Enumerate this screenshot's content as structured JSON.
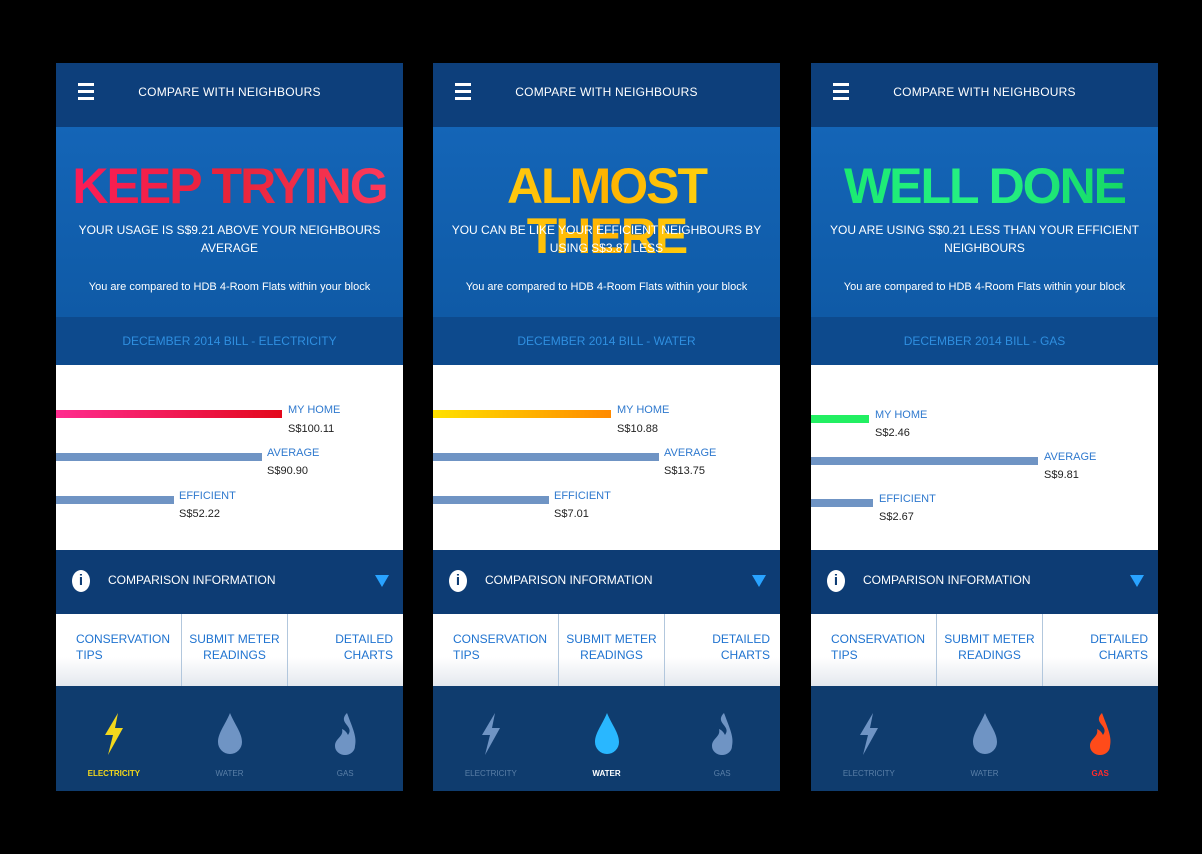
{
  "screens": [
    {
      "title": "COMPARE WITH NEIGHBOURS",
      "headline": "KEEP TRYING",
      "subtitle": "YOUR USAGE IS S$9.21 ABOVE YOUR NEIGHBOURS AVERAGE",
      "compared_text": "You are compared to HDB 4-Room Flats within your block",
      "bill_label": "DECEMBER 2014 BILL - ELECTRICITY",
      "bars": [
        {
          "label": "MY HOME",
          "value": "S$100.11",
          "amount": 100.11
        },
        {
          "label": "AVERAGE",
          "value": "S$90.90",
          "amount": 90.9
        },
        {
          "label": "EFFICIENT",
          "value": "S$52.22",
          "amount": 52.22
        }
      ],
      "info_label": "COMPARISON INFORMATION",
      "actions": [
        "CONSERVATION TIPS",
        "SUBMIT METER READINGS",
        "DETAILED CHARTS"
      ],
      "tabs": [
        "ELECTRICITY",
        "WATER",
        "GAS"
      ],
      "active_tab": "ELECTRICITY"
    },
    {
      "title": "COMPARE WITH NEIGHBOURS",
      "headline": "ALMOST THERE",
      "subtitle": "YOU CAN BE LIKE YOUR EFFICIENT NEIGHBOURS BY USING S$3.87 LESS",
      "compared_text": "You are compared to HDB 4-Room Flats within your block",
      "bill_label": "DECEMBER 2014 BILL - WATER",
      "bars": [
        {
          "label": "MY HOME",
          "value": "S$10.88",
          "amount": 10.88
        },
        {
          "label": "AVERAGE",
          "value": "S$13.75",
          "amount": 13.75
        },
        {
          "label": "EFFICIENT",
          "value": "S$7.01",
          "amount": 7.01
        }
      ],
      "info_label": "COMPARISON INFORMATION",
      "actions": [
        "CONSERVATION TIPS",
        "SUBMIT METER READINGS",
        "DETAILED CHARTS"
      ],
      "tabs": [
        "ELECTRICITY",
        "WATER",
        "GAS"
      ],
      "active_tab": "WATER"
    },
    {
      "title": "COMPARE WITH NEIGHBOURS",
      "headline": "WELL DONE",
      "subtitle": "YOU ARE USING S$0.21 LESS THAN YOUR EFFICIENT NEIGHBOURS",
      "compared_text": "You are compared to HDB 4-Room Flats within your block",
      "bill_label": "DECEMBER 2014 BILL - GAS",
      "bars": [
        {
          "label": "MY HOME",
          "value": "S$2.46",
          "amount": 2.46
        },
        {
          "label": "AVERAGE",
          "value": "S$9.81",
          "amount": 9.81
        },
        {
          "label": "EFFICIENT",
          "value": "S$2.67",
          "amount": 2.67
        }
      ],
      "info_label": "COMPARISON INFORMATION",
      "actions": [
        "CONSERVATION TIPS",
        "SUBMIT METER READINGS",
        "DETAILED CHARTS"
      ],
      "tabs": [
        "ELECTRICITY",
        "WATER",
        "GAS"
      ],
      "active_tab": "GAS"
    }
  ],
  "colors": {
    "keep_trying": "#e7243a",
    "almost_there": "#ffc20e",
    "well_done": "#1ee56b",
    "accent_blue": "#1f73d0",
    "electricity_active": "#f3d81c",
    "water_active": "#29b7ff",
    "gas_active": "#ff4b1a"
  },
  "icons": [
    "menu-icon",
    "info-icon",
    "triangle-down-icon",
    "lightning-icon",
    "water-drop-icon",
    "flame-icon"
  ]
}
